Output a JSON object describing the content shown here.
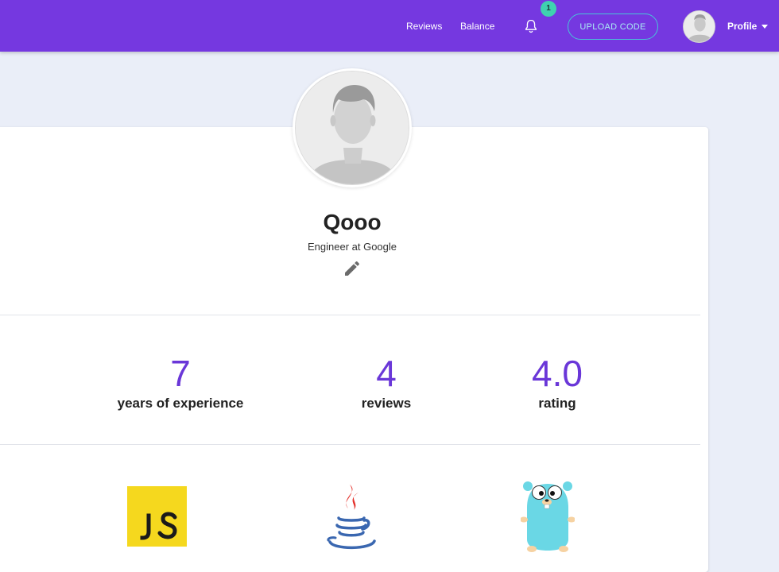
{
  "navbar": {
    "links": [
      "Reviews",
      "Balance"
    ],
    "notification_count": "1",
    "upload_button": "UPLOAD CODE",
    "profile_label": "Profile",
    "colors": {
      "background": "#7538e0",
      "badge": "#3fd1b0",
      "upload_border": "#47c6d8"
    }
  },
  "profile": {
    "name": "Qooo",
    "job": "Engineer at Google"
  },
  "stats": [
    {
      "value": "7",
      "label": "years of experience"
    },
    {
      "value": "4",
      "label": "reviews"
    },
    {
      "value": "4.0",
      "label": "rating"
    }
  ],
  "languages": [
    "javascript-logo",
    "java-logo",
    "go-gopher-logo"
  ],
  "icons": {
    "notification": "bell-icon",
    "edit": "pencil-icon",
    "dropdown": "caret-down-icon"
  },
  "colors": {
    "accent": "#6a37d8",
    "page_background": "#eaeef8"
  }
}
